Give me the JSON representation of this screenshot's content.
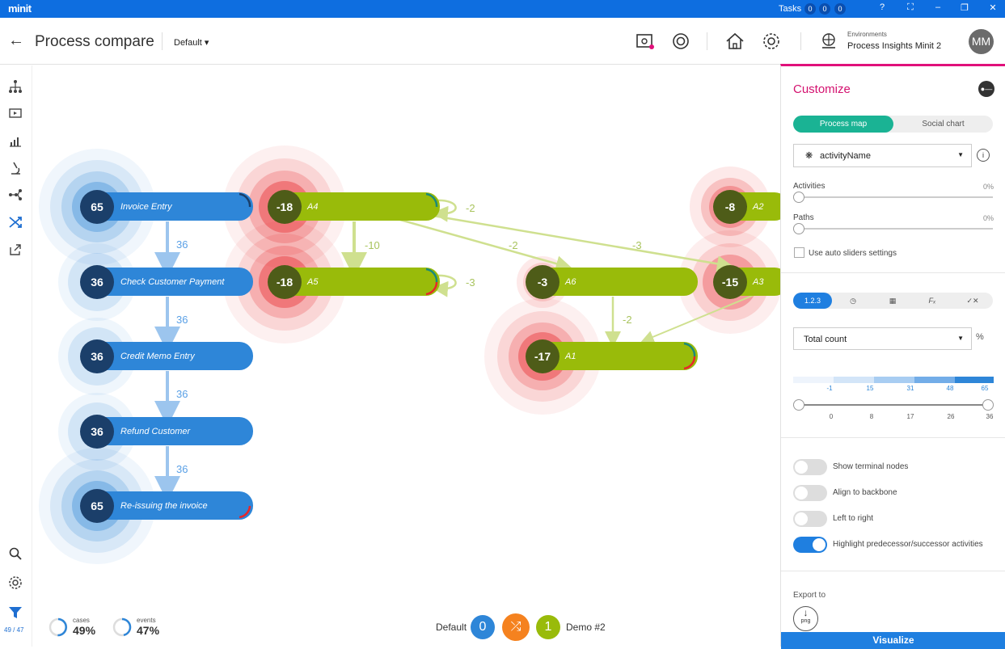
{
  "titlebar": {
    "logo": "minit",
    "tasks_label": "Tasks",
    "task_counts": [
      "0",
      "0",
      "0"
    ],
    "window_buttons": [
      "?",
      "⛶",
      "–",
      "❐",
      "✕"
    ]
  },
  "header": {
    "title": "Process compare",
    "view_select": "Default",
    "env_label": "Environments",
    "env_value": "Process Insights Minit 2",
    "avatar": "MM"
  },
  "leftnav": {
    "icons": [
      "hierarchy-icon",
      "presentation-icon",
      "chart-icon",
      "microscope-icon",
      "flow-icon",
      "compare-icon",
      "export-icon",
      "search-icon",
      "gear-icon",
      "filter-icon"
    ],
    "filter_count": "49 / 47"
  },
  "map": {
    "blue_nodes": [
      {
        "count": "65",
        "label": "Invoice Entry"
      },
      {
        "count": "36",
        "label": "Check Customer Payment"
      },
      {
        "count": "36",
        "label": "Credit Memo Entry"
      },
      {
        "count": "36",
        "label": "Refund Customer"
      },
      {
        "count": "65",
        "label": "Re-issuing the invoice"
      }
    ],
    "green_nodes": [
      {
        "count": "-18",
        "label": "A4"
      },
      {
        "count": "-18",
        "label": "A5"
      },
      {
        "count": "-3",
        "label": "A6"
      },
      {
        "count": "-8",
        "label": "A2"
      },
      {
        "count": "-15",
        "label": "A3"
      },
      {
        "count": "-17",
        "label": "A1"
      }
    ],
    "blue_edges": [
      "36",
      "36",
      "36",
      "36"
    ],
    "green_edges": [
      "-2",
      "-10",
      "-2",
      "-3",
      "-3",
      "-2"
    ],
    "colors": {
      "blue": "#2e86d8",
      "green": "#99bb0a",
      "dark_blue": "#1b3f6a",
      "dark_green": "#4e5c18",
      "red": "#e8262a"
    }
  },
  "stats": {
    "cases_label": "cases",
    "cases_value": "49%",
    "events_label": "events",
    "events_value": "47%"
  },
  "legend": {
    "left": "Default",
    "left_value": "0",
    "right_value": "1",
    "right": "Demo #2"
  },
  "panel": {
    "title": "Customize",
    "tabs": [
      "Process map",
      "Social chart"
    ],
    "attribute": "activityName",
    "activities_label": "Activities",
    "activities_pct": "0%",
    "paths_label": "Paths",
    "paths_pct": "0%",
    "auto_sliders": "Use auto sliders settings",
    "metric_tabs": [
      "1.2.3",
      "clock-icon",
      "briefcase-icon",
      "function-icon",
      "check-cross-icon"
    ],
    "metric": "Total count",
    "pct_btn": "%",
    "scale_top": [
      "-1",
      "15",
      "31",
      "48",
      "65"
    ],
    "scale_bottom": [
      "0",
      "8",
      "17",
      "26",
      "36"
    ],
    "toggles": [
      {
        "label": "Show terminal nodes",
        "on": false
      },
      {
        "label": "Align to backbone",
        "on": false
      },
      {
        "label": "Left to right",
        "on": false
      },
      {
        "label": "Highlight predecessor/successor activities",
        "on": true
      }
    ],
    "export_label": "Export to",
    "export_format": "png",
    "visualize": "Visualize"
  }
}
